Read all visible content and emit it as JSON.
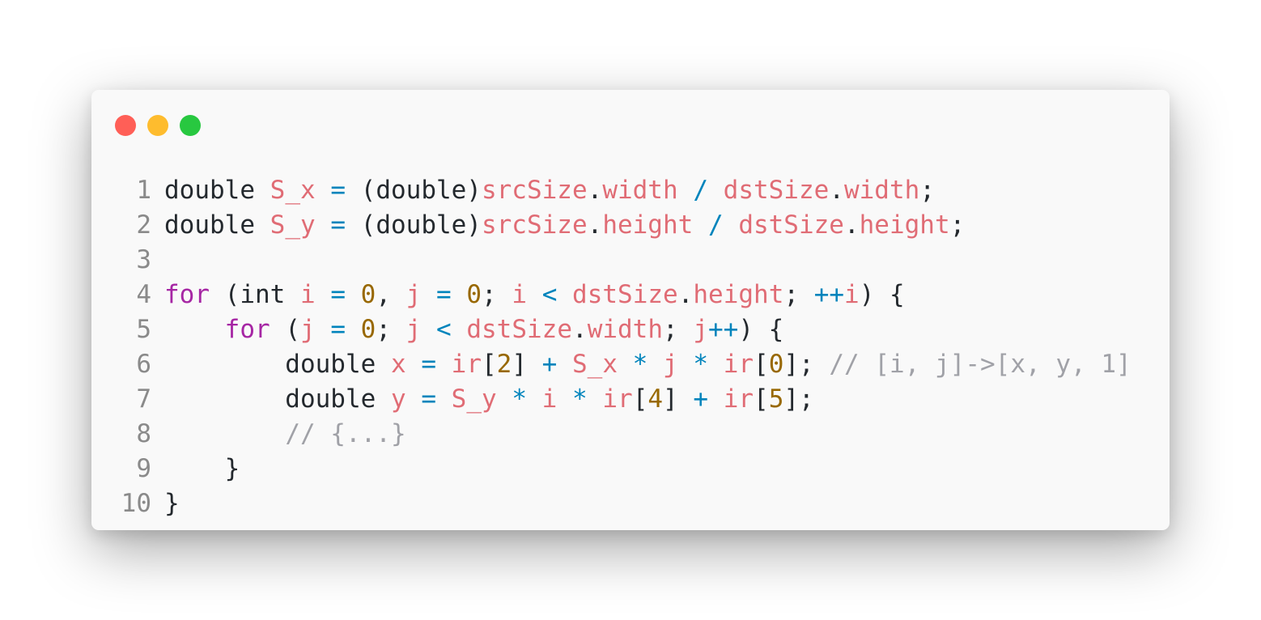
{
  "window": {
    "traffic_lights": {
      "close_color": "#ff5f57",
      "minimize_color": "#febc2e",
      "maximize_color": "#28c840"
    }
  },
  "code": {
    "language": "C++",
    "lines": [
      {
        "number": "1",
        "tokens": [
          {
            "t": "double",
            "c": "ty"
          },
          {
            "t": " ",
            "c": "pn"
          },
          {
            "t": "S_x",
            "c": "var"
          },
          {
            "t": " ",
            "c": "pn"
          },
          {
            "t": "=",
            "c": "op"
          },
          {
            "t": " (double)",
            "c": "pn"
          },
          {
            "t": "srcSize",
            "c": "var"
          },
          {
            "t": ".",
            "c": "pn"
          },
          {
            "t": "width",
            "c": "var"
          },
          {
            "t": " ",
            "c": "pn"
          },
          {
            "t": "/",
            "c": "op"
          },
          {
            "t": " ",
            "c": "pn"
          },
          {
            "t": "dstSize",
            "c": "var"
          },
          {
            "t": ".",
            "c": "pn"
          },
          {
            "t": "width",
            "c": "var"
          },
          {
            "t": ";",
            "c": "pn"
          }
        ]
      },
      {
        "number": "2",
        "tokens": [
          {
            "t": "double",
            "c": "ty"
          },
          {
            "t": " ",
            "c": "pn"
          },
          {
            "t": "S_y",
            "c": "var"
          },
          {
            "t": " ",
            "c": "pn"
          },
          {
            "t": "=",
            "c": "op"
          },
          {
            "t": " (double)",
            "c": "pn"
          },
          {
            "t": "srcSize",
            "c": "var"
          },
          {
            "t": ".",
            "c": "pn"
          },
          {
            "t": "height",
            "c": "var"
          },
          {
            "t": " ",
            "c": "pn"
          },
          {
            "t": "/",
            "c": "op"
          },
          {
            "t": " ",
            "c": "pn"
          },
          {
            "t": "dstSize",
            "c": "var"
          },
          {
            "t": ".",
            "c": "pn"
          },
          {
            "t": "height",
            "c": "var"
          },
          {
            "t": ";",
            "c": "pn"
          }
        ]
      },
      {
        "number": "3",
        "tokens": []
      },
      {
        "number": "4",
        "tokens": [
          {
            "t": "for",
            "c": "kw"
          },
          {
            "t": " (int ",
            "c": "pn"
          },
          {
            "t": "i",
            "c": "var"
          },
          {
            "t": " ",
            "c": "pn"
          },
          {
            "t": "=",
            "c": "op"
          },
          {
            "t": " ",
            "c": "pn"
          },
          {
            "t": "0",
            "c": "num"
          },
          {
            "t": ", ",
            "c": "pn"
          },
          {
            "t": "j",
            "c": "var"
          },
          {
            "t": " ",
            "c": "pn"
          },
          {
            "t": "=",
            "c": "op"
          },
          {
            "t": " ",
            "c": "pn"
          },
          {
            "t": "0",
            "c": "num"
          },
          {
            "t": "; ",
            "c": "pn"
          },
          {
            "t": "i",
            "c": "var"
          },
          {
            "t": " ",
            "c": "pn"
          },
          {
            "t": "<",
            "c": "op"
          },
          {
            "t": " ",
            "c": "pn"
          },
          {
            "t": "dstSize",
            "c": "var"
          },
          {
            "t": ".",
            "c": "pn"
          },
          {
            "t": "height",
            "c": "var"
          },
          {
            "t": "; ",
            "c": "pn"
          },
          {
            "t": "++",
            "c": "op"
          },
          {
            "t": "i",
            "c": "var"
          },
          {
            "t": ") {",
            "c": "pn"
          }
        ]
      },
      {
        "number": "5",
        "tokens": [
          {
            "t": "    ",
            "c": "pn"
          },
          {
            "t": "for",
            "c": "kw"
          },
          {
            "t": " (",
            "c": "pn"
          },
          {
            "t": "j",
            "c": "var"
          },
          {
            "t": " ",
            "c": "pn"
          },
          {
            "t": "=",
            "c": "op"
          },
          {
            "t": " ",
            "c": "pn"
          },
          {
            "t": "0",
            "c": "num"
          },
          {
            "t": "; ",
            "c": "pn"
          },
          {
            "t": "j",
            "c": "var"
          },
          {
            "t": " ",
            "c": "pn"
          },
          {
            "t": "<",
            "c": "op"
          },
          {
            "t": " ",
            "c": "pn"
          },
          {
            "t": "dstSize",
            "c": "var"
          },
          {
            "t": ".",
            "c": "pn"
          },
          {
            "t": "width",
            "c": "var"
          },
          {
            "t": "; ",
            "c": "pn"
          },
          {
            "t": "j",
            "c": "var"
          },
          {
            "t": "++",
            "c": "op"
          },
          {
            "t": ") {",
            "c": "pn"
          }
        ]
      },
      {
        "number": "6",
        "tokens": [
          {
            "t": "        double ",
            "c": "pn"
          },
          {
            "t": "x",
            "c": "var"
          },
          {
            "t": " ",
            "c": "pn"
          },
          {
            "t": "=",
            "c": "op"
          },
          {
            "t": " ",
            "c": "pn"
          },
          {
            "t": "ir",
            "c": "var"
          },
          {
            "t": "[",
            "c": "pn"
          },
          {
            "t": "2",
            "c": "num"
          },
          {
            "t": "] ",
            "c": "pn"
          },
          {
            "t": "+",
            "c": "op"
          },
          {
            "t": " ",
            "c": "pn"
          },
          {
            "t": "S_x",
            "c": "var"
          },
          {
            "t": " ",
            "c": "pn"
          },
          {
            "t": "*",
            "c": "op"
          },
          {
            "t": " ",
            "c": "pn"
          },
          {
            "t": "j",
            "c": "var"
          },
          {
            "t": " ",
            "c": "pn"
          },
          {
            "t": "*",
            "c": "op"
          },
          {
            "t": " ",
            "c": "pn"
          },
          {
            "t": "ir",
            "c": "var"
          },
          {
            "t": "[",
            "c": "pn"
          },
          {
            "t": "0",
            "c": "num"
          },
          {
            "t": "]; ",
            "c": "pn"
          },
          {
            "t": "// [i, j]->[x, y, 1]",
            "c": "cm"
          }
        ]
      },
      {
        "number": "7",
        "tokens": [
          {
            "t": "        double ",
            "c": "pn"
          },
          {
            "t": "y",
            "c": "var"
          },
          {
            "t": " ",
            "c": "pn"
          },
          {
            "t": "=",
            "c": "op"
          },
          {
            "t": " ",
            "c": "pn"
          },
          {
            "t": "S_y",
            "c": "var"
          },
          {
            "t": " ",
            "c": "pn"
          },
          {
            "t": "*",
            "c": "op"
          },
          {
            "t": " ",
            "c": "pn"
          },
          {
            "t": "i",
            "c": "var"
          },
          {
            "t": " ",
            "c": "pn"
          },
          {
            "t": "*",
            "c": "op"
          },
          {
            "t": " ",
            "c": "pn"
          },
          {
            "t": "ir",
            "c": "var"
          },
          {
            "t": "[",
            "c": "pn"
          },
          {
            "t": "4",
            "c": "num"
          },
          {
            "t": "] ",
            "c": "pn"
          },
          {
            "t": "+",
            "c": "op"
          },
          {
            "t": " ",
            "c": "pn"
          },
          {
            "t": "ir",
            "c": "var"
          },
          {
            "t": "[",
            "c": "pn"
          },
          {
            "t": "5",
            "c": "num"
          },
          {
            "t": "];",
            "c": "pn"
          }
        ]
      },
      {
        "number": "8",
        "tokens": [
          {
            "t": "        ",
            "c": "pn"
          },
          {
            "t": "// {...}",
            "c": "cm"
          }
        ]
      },
      {
        "number": "9",
        "tokens": [
          {
            "t": "    }",
            "c": "pn"
          }
        ]
      },
      {
        "number": "10",
        "tokens": [
          {
            "t": "}",
            "c": "pn"
          }
        ]
      }
    ]
  }
}
